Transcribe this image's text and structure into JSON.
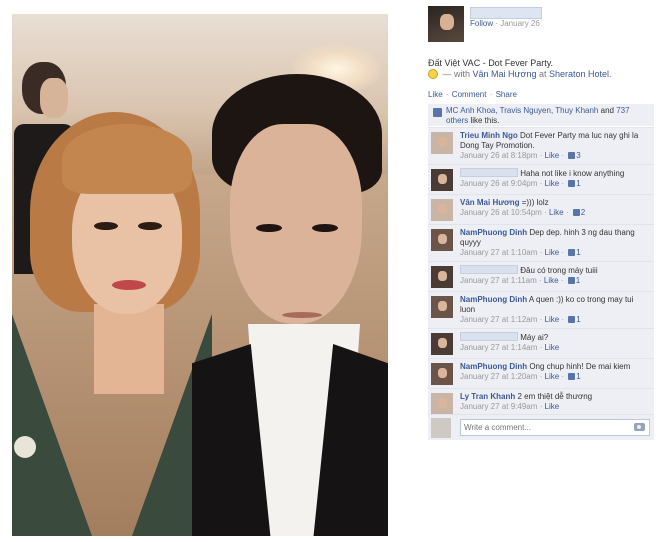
{
  "post": {
    "follow_label": "Follow",
    "separator": " · ",
    "date": "January 26",
    "title": "Đất Việt VAC - Dot Fever Party.",
    "with_prefix": " — with ",
    "tagged_person": "Vân Mai Hương",
    "at_word": " at ",
    "place": "Sheraton Hotel",
    "period": "."
  },
  "actions": {
    "like": "Like",
    "comment": "Comment",
    "share": "Share",
    "dot": " · "
  },
  "likes": {
    "names": "MC Anh Khoa, Travis Nguyen, Thuy Khanh",
    "and_word": " and ",
    "others": "737 others",
    "suffix": " like this."
  },
  "comments": [
    {
      "author": "Trieu Minh Ngo",
      "text": " Dot Fever Party ma luc nay ghi la Dong Tay Promotion.",
      "time": "January 26 at 8:18pm",
      "like": "Like",
      "likes": "3"
    },
    {
      "author": "",
      "text": " Haha not like i know anything",
      "time": "January 26 at 9:04pm",
      "like": "Like",
      "likes": "1"
    },
    {
      "author": "Vân Mai Hương",
      "text": " =))) lolz",
      "time": "January 26 at 10:54pm",
      "like": "Like",
      "likes": "2"
    },
    {
      "author": "NamPhuong Dinh",
      "text": " Dep dep. hinh 3 ng dau thang quyyy",
      "time": "January 27 at 1:10am",
      "like": "Like",
      "likes": "1"
    },
    {
      "author": "",
      "text": " Đâu có trong máy tuiii",
      "time": "January 27 at 1:11am",
      "like": "Like",
      "likes": "1"
    },
    {
      "author": "NamPhuong Dinh",
      "text": " A quen :)) ko co trong may tui luon",
      "time": "January 27 at 1:12am",
      "like": "Like",
      "likes": "1"
    },
    {
      "author": "",
      "text": " Máy ai?",
      "time": "January 27 at 1:14am",
      "like": "Like",
      "likes": ""
    },
    {
      "author": "NamPhuong Dinh",
      "text": " Ong chup hinh! De mai kiem",
      "time": "January 27 at 1:20am",
      "like": "Like",
      "likes": "1"
    },
    {
      "author": "Ly Tran Khanh",
      "text": " 2 em thiệt dễ thương",
      "time": "January 27 at 9:49am",
      "like": "Like",
      "likes": ""
    }
  ],
  "composer": {
    "placeholder": "Write a comment..."
  }
}
